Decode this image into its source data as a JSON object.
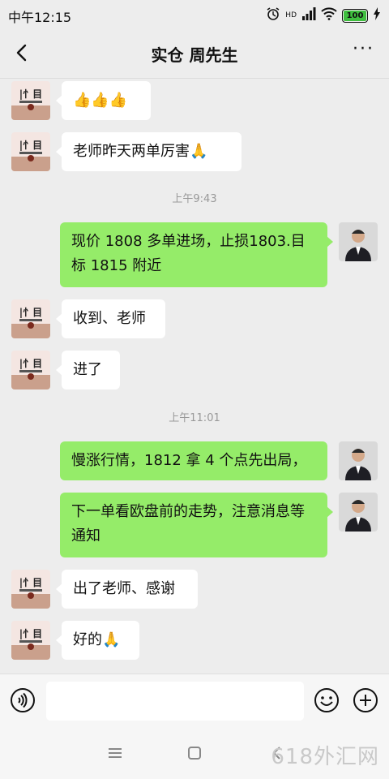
{
  "status_bar": {
    "time": "中午12:15",
    "signal_label": "HD",
    "battery": "100"
  },
  "header": {
    "title": "实仓 周先生",
    "more": "···"
  },
  "messages": [
    {
      "text": "👍👍👍"
    },
    {
      "text": "老师昨天两单厉害🙏"
    },
    {
      "text": "上午9:43"
    },
    {
      "text": "现价 1808 多单进场，止损1803.目标 1815 附近"
    },
    {
      "text": "收到、老师"
    },
    {
      "text": "进了"
    },
    {
      "text": "上午11:01"
    },
    {
      "text": "慢涨行情，1812 拿 4 个点先出局，"
    },
    {
      "text": "下一单看欧盘前的走势，注意消息等通知"
    },
    {
      "text": "出了老师、感谢"
    },
    {
      "text": "好的🙏"
    }
  ],
  "input": {
    "value": "",
    "placeholder": ""
  },
  "watermark": "618外汇网",
  "colors": {
    "outgoing_bubble": "#95ec69",
    "incoming_bubble": "#ffffff",
    "background": "#ededed"
  }
}
